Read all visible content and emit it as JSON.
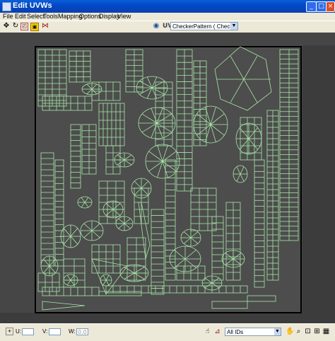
{
  "window": {
    "title": "Edit UVWs"
  },
  "menu": [
    "File",
    "Edit",
    "Select",
    "Tools",
    "Mapping",
    "Options",
    "Display",
    "View"
  ],
  "toolbar": {
    "uv_label": "UV",
    "texture_select": "CheckerPattern  ( Checker )"
  },
  "status": {
    "u_label": "U:",
    "v_label": "V:",
    "w_label": "W:",
    "u_value": "",
    "v_value": "",
    "w_value": "0.0",
    "id_filter": "All IDs"
  },
  "colors": {
    "viewport_bg": "#464646",
    "uv_edge": "#a8e6a8",
    "uv_frame": "#000000"
  },
  "icons": [
    "move-icon",
    "rotate-icon",
    "scale-icon",
    "freeform-icon",
    "mirror-icon",
    "texture-icon",
    "lock-icon",
    "filter-icon",
    "pan-icon",
    "zoom-icon",
    "zoom-region-icon",
    "zoom-extents-icon",
    "grid-icon"
  ]
}
